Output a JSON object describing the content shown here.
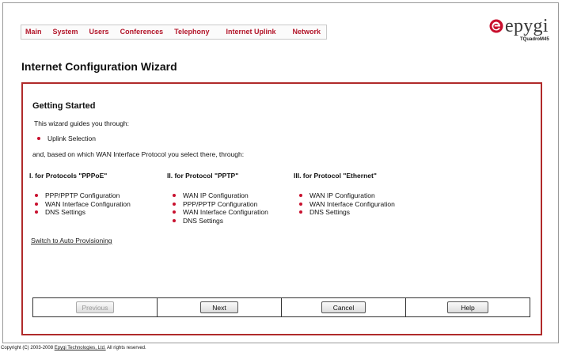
{
  "nav": {
    "items": [
      "Main",
      "System",
      "Users",
      "Conferences",
      "Telephony",
      "Internet Uplink",
      "Network"
    ]
  },
  "logo": {
    "brand": "epygi",
    "model": "TQuadroM45",
    "accent": "#c8102e"
  },
  "page_title": "Internet Configuration Wizard",
  "panel": {
    "section_title": "Getting Started",
    "intro": "This wizard guides you through:",
    "uplink_item": "Uplink Selection",
    "based": "and, based on which WAN Interface Protocol you select there, through:",
    "columns": [
      {
        "heading": "I. for Protocols \"PPPoE\"",
        "items": [
          "PPP/PPTP Configuration",
          "WAN Interface Configuration",
          "DNS Settings"
        ]
      },
      {
        "heading": "II. for Protocol \"PPTP\"",
        "items": [
          "WAN IP Configuration",
          "PPP/PPTP Configuration",
          "WAN Interface Configuration",
          "DNS Settings"
        ]
      },
      {
        "heading": "III. for Protocol \"Ethernet\"",
        "items": [
          "WAN IP Configuration",
          "WAN Interface Configuration",
          "DNS Settings"
        ]
      }
    ],
    "auto_link": "Switch to Auto Provisioning"
  },
  "buttons": {
    "previous": "Previous",
    "next": "Next",
    "cancel": "Cancel",
    "help": "Help"
  },
  "footer": {
    "prefix": "Copyright (C) 2003-2008 ",
    "company": "Epygi Technologies, Ltd.",
    "suffix": " All rights reserved."
  },
  "colors": {
    "nav_text": "#b3162a",
    "panel_border": "#b02a2a",
    "bullet": "#c8102e"
  }
}
